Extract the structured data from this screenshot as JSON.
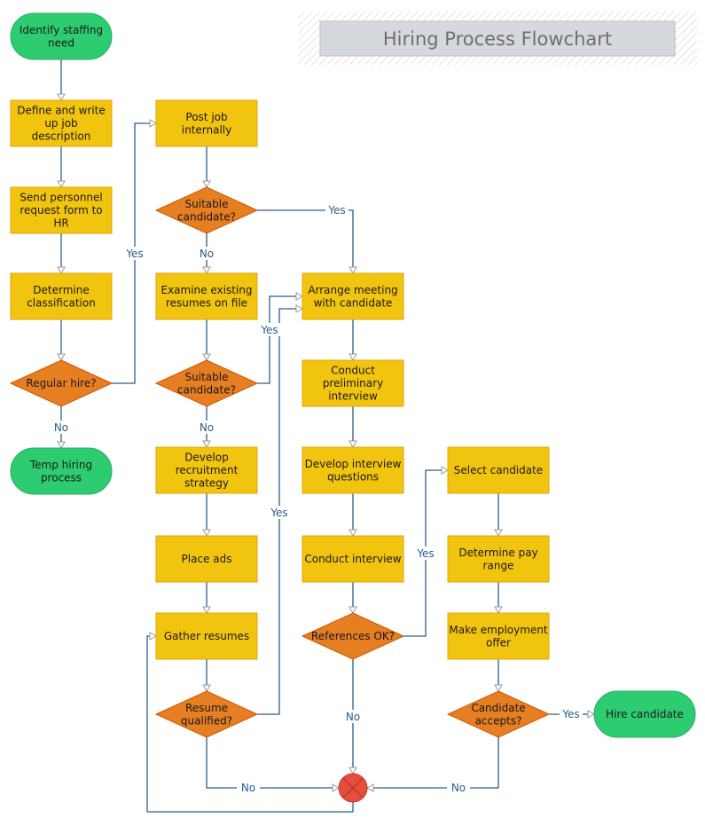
{
  "title": "Hiring Process Flowchart",
  "colors": {
    "terminator": "#2ecc71",
    "terminator_stroke": "#27ae60",
    "process": "#f1c40f",
    "process_stroke": "#e5a50a",
    "decision": "#e67e22",
    "decision_stroke": "#d35400",
    "end_circle": "#e74c3c",
    "end_circle_stroke": "#c0392b",
    "connector": "#2b5d8c",
    "arrowhead": "#999999",
    "title_bg": "#d5d8dc",
    "title_text": "#6e6e6e"
  },
  "nodes": [
    {
      "id": "identify",
      "type": "terminator",
      "lines": [
        "Identify staffing",
        "need"
      ]
    },
    {
      "id": "define",
      "type": "process",
      "lines": [
        "Define and write",
        "up job",
        "description"
      ]
    },
    {
      "id": "send",
      "type": "process",
      "lines": [
        "Send personnel",
        "request form to",
        "HR"
      ]
    },
    {
      "id": "classify",
      "type": "process",
      "lines": [
        "Determine",
        "classification"
      ]
    },
    {
      "id": "regular",
      "type": "decision",
      "lines": [
        "Regular hire?"
      ]
    },
    {
      "id": "temp",
      "type": "terminator",
      "lines": [
        "Temp hiring",
        "process"
      ]
    },
    {
      "id": "post",
      "type": "process",
      "lines": [
        "Post job",
        "internally"
      ]
    },
    {
      "id": "suitable1",
      "type": "decision",
      "lines": [
        "Suitable",
        "candidate?"
      ]
    },
    {
      "id": "examine",
      "type": "process",
      "lines": [
        "Examine existing",
        "resumes on file"
      ]
    },
    {
      "id": "suitable2",
      "type": "decision",
      "lines": [
        "Suitable",
        "candidate?"
      ]
    },
    {
      "id": "strategy",
      "type": "process",
      "lines": [
        "Develop",
        "recruitment",
        "strategy"
      ]
    },
    {
      "id": "ads",
      "type": "process",
      "lines": [
        "Place ads"
      ]
    },
    {
      "id": "gather",
      "type": "process",
      "lines": [
        "Gather resumes"
      ]
    },
    {
      "id": "qualified",
      "type": "decision",
      "lines": [
        "Resume",
        "qualified?"
      ]
    },
    {
      "id": "arrange",
      "type": "process",
      "lines": [
        "Arrange meeting",
        "with candidate"
      ]
    },
    {
      "id": "prelim",
      "type": "process",
      "lines": [
        "Conduct",
        "preliminary",
        "interview"
      ]
    },
    {
      "id": "questions",
      "type": "process",
      "lines": [
        "Develop interview",
        "questions"
      ]
    },
    {
      "id": "interview",
      "type": "process",
      "lines": [
        "Conduct interview"
      ]
    },
    {
      "id": "references",
      "type": "decision",
      "lines": [
        "References OK?"
      ]
    },
    {
      "id": "select",
      "type": "process",
      "lines": [
        "Select candidate"
      ]
    },
    {
      "id": "payrange",
      "type": "process",
      "lines": [
        "Determine pay",
        "range"
      ]
    },
    {
      "id": "offer",
      "type": "process",
      "lines": [
        "Make employment",
        "offer"
      ]
    },
    {
      "id": "accepts",
      "type": "decision",
      "lines": [
        "Candidate",
        "accepts?"
      ]
    },
    {
      "id": "hire",
      "type": "terminator",
      "lines": [
        "Hire candidate"
      ]
    },
    {
      "id": "end",
      "type": "end-circle",
      "lines": []
    }
  ],
  "edges": [
    {
      "from": "identify",
      "to": "define",
      "label": ""
    },
    {
      "from": "define",
      "to": "send",
      "label": ""
    },
    {
      "from": "send",
      "to": "classify",
      "label": ""
    },
    {
      "from": "classify",
      "to": "regular",
      "label": ""
    },
    {
      "from": "regular",
      "to": "temp",
      "label": "No"
    },
    {
      "from": "regular",
      "to": "post",
      "label": "Yes"
    },
    {
      "from": "post",
      "to": "suitable1",
      "label": ""
    },
    {
      "from": "suitable1",
      "to": "arrange",
      "label": "Yes"
    },
    {
      "from": "suitable1",
      "to": "examine",
      "label": "No"
    },
    {
      "from": "examine",
      "to": "suitable2",
      "label": ""
    },
    {
      "from": "suitable2",
      "to": "arrange",
      "label": "Yes"
    },
    {
      "from": "suitable2",
      "to": "strategy",
      "label": "No"
    },
    {
      "from": "strategy",
      "to": "ads",
      "label": ""
    },
    {
      "from": "ads",
      "to": "gather",
      "label": ""
    },
    {
      "from": "gather",
      "to": "qualified",
      "label": ""
    },
    {
      "from": "qualified",
      "to": "arrange",
      "label": "Yes"
    },
    {
      "from": "qualified",
      "to": "end",
      "label": "No"
    },
    {
      "from": "arrange",
      "to": "prelim",
      "label": ""
    },
    {
      "from": "prelim",
      "to": "questions",
      "label": ""
    },
    {
      "from": "questions",
      "to": "interview",
      "label": ""
    },
    {
      "from": "interview",
      "to": "references",
      "label": ""
    },
    {
      "from": "references",
      "to": "select",
      "label": "Yes"
    },
    {
      "from": "references",
      "to": "end",
      "label": "No"
    },
    {
      "from": "select",
      "to": "payrange",
      "label": ""
    },
    {
      "from": "payrange",
      "to": "offer",
      "label": ""
    },
    {
      "from": "offer",
      "to": "accepts",
      "label": ""
    },
    {
      "from": "accepts",
      "to": "hire",
      "label": "Yes"
    },
    {
      "from": "accepts",
      "to": "end",
      "label": "No"
    },
    {
      "from": "end",
      "to": "gather",
      "label": ""
    }
  ]
}
